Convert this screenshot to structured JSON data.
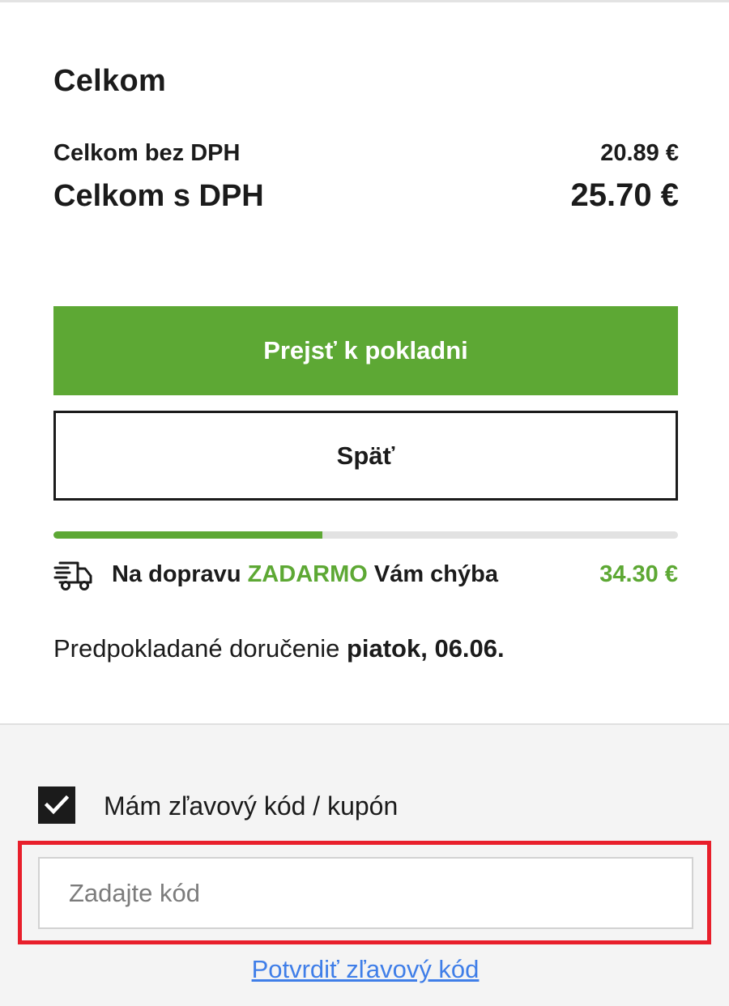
{
  "summary": {
    "title": "Celkom",
    "net_label": "Celkom bez DPH",
    "net_value": "20.89 €",
    "gross_label": "Celkom s DPH",
    "gross_value": "25.70 €"
  },
  "actions": {
    "checkout_label": "Prejsť k pokladni",
    "back_label": "Späť"
  },
  "shipping": {
    "progress_fraction": 0.43,
    "text_before": "Na dopravu ",
    "text_free": "ZADARMO",
    "text_after": " Vám chýba",
    "amount": "34.30 €",
    "icon": "delivery-truck-icon"
  },
  "delivery": {
    "text": "Predpokladané doručenie ",
    "date": "piatok, 06.06."
  },
  "coupon": {
    "checked": true,
    "label": "Mám zľavový kód / kupón",
    "input_value": "",
    "placeholder": "Zadajte kód",
    "confirm_label": "Potvrdiť zľavový kód"
  },
  "colors": {
    "accent_green": "#5da834",
    "highlight_red": "#e81f2b",
    "link_blue": "#3f7ee8",
    "text_dark": "#1b1b1b"
  }
}
